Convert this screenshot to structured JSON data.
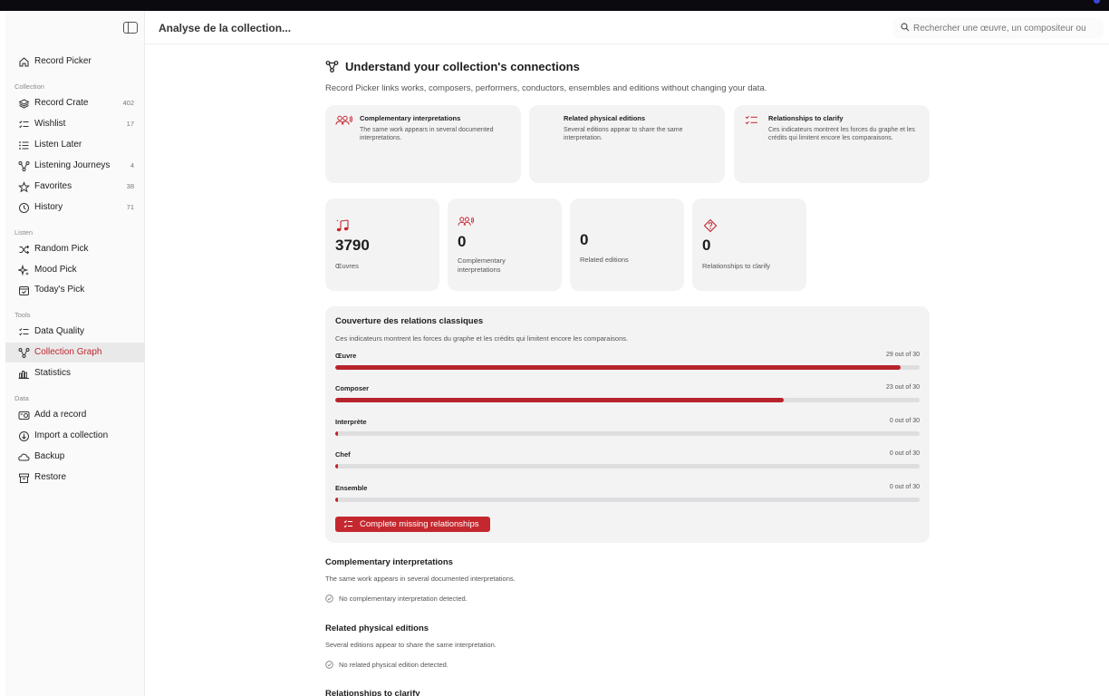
{
  "header": {
    "title": "Analyse de la collection...",
    "search_placeholder": "Rechercher une œuvre, un compositeur ou"
  },
  "sidebar": {
    "app_item": {
      "label": "Record Picker",
      "icon": "home-icon"
    },
    "sections": [
      {
        "label": "Collection",
        "items": [
          {
            "label": "Record Crate",
            "count": "402",
            "icon": "layers-icon"
          },
          {
            "label": "Wishlist",
            "count": "17",
            "icon": "checklist-icon"
          },
          {
            "label": "Listen Later",
            "count": "",
            "icon": "list-icon"
          },
          {
            "label": "Listening Journeys",
            "count": "4",
            "icon": "graph-icon"
          },
          {
            "label": "Favorites",
            "count": "38",
            "icon": "star-icon"
          },
          {
            "label": "History",
            "count": "71",
            "icon": "clock-icon"
          }
        ]
      },
      {
        "label": "Listen",
        "items": [
          {
            "label": "Random Pick",
            "icon": "shuffle-icon"
          },
          {
            "label": "Mood Pick",
            "icon": "sparkle-icon"
          },
          {
            "label": "Today's Pick",
            "icon": "calendar-icon"
          }
        ]
      },
      {
        "label": "Tools",
        "items": [
          {
            "label": "Data Quality",
            "icon": "checklist-icon"
          },
          {
            "label": "Collection Graph",
            "icon": "graph-icon",
            "active": true
          },
          {
            "label": "Statistics",
            "icon": "bar-chart-icon"
          }
        ]
      },
      {
        "label": "Data",
        "items": [
          {
            "label": "Add a record",
            "icon": "add-record-icon"
          },
          {
            "label": "Import a collection",
            "icon": "import-icon"
          },
          {
            "label": "Backup",
            "icon": "cloud-icon"
          },
          {
            "label": "Restore",
            "icon": "archive-icon"
          }
        ]
      }
    ]
  },
  "main": {
    "title": "Understand your collection's connections",
    "subtitle": "Record Picker links works, composers, performers, conductors, ensembles and editions without changing your data.",
    "intro_cards": [
      {
        "title": "Complementary interpretations",
        "desc": "The same work appears in several documented interpretations.",
        "icon": "people-icon"
      },
      {
        "title": "Related physical editions",
        "desc": "Several editions appear to share the same interpretation.",
        "icon": ""
      },
      {
        "title": "Relationships to clarify",
        "desc": "Ces indicateurs montrent les forces du graphe et les crédits qui limitent encore les comparaisons.",
        "icon": "checklist-icon"
      }
    ],
    "stats": [
      {
        "value": "3790",
        "label": "Œuvres",
        "icon": "music-notes-icon"
      },
      {
        "value": "0",
        "label": "Complementary interpretations",
        "icon": "people-icon"
      },
      {
        "value": "0",
        "label": "Related editions",
        "icon": ""
      },
      {
        "value": "0",
        "label": "Relationships to clarify",
        "icon": "diamond-question-icon"
      }
    ],
    "coverage": {
      "title": "Couverture des relations classiques",
      "desc": "Ces indicateurs montrent les forces du graphe et les crédits qui limitent encore les comparaisons.",
      "rows": [
        {
          "name": "Œuvre",
          "count_text": "29 out of 30",
          "value": 29,
          "max": 30
        },
        {
          "name": "Composer",
          "count_text": "23 out of 30",
          "value": 23,
          "max": 30
        },
        {
          "name": "Interprète",
          "count_text": "0 out of 30",
          "value": 0,
          "max": 30
        },
        {
          "name": "Chef",
          "count_text": "0 out of 30",
          "value": 0,
          "max": 30
        },
        {
          "name": "Ensemble",
          "count_text": "0 out of 30",
          "value": 0,
          "max": 30
        }
      ],
      "button_label": "Complete missing relationships"
    },
    "sections": [
      {
        "title": "Complementary interpretations",
        "desc": "The same work appears in several documented interpretations.",
        "empty": "No complementary interpretation detected."
      },
      {
        "title": "Related physical editions",
        "desc": "Several editions appear to share the same interpretation.",
        "empty": "No related physical edition detected."
      },
      {
        "title": "Relationships to clarify"
      }
    ]
  },
  "colors": {
    "accent": "#c4282e",
    "bar_fill": "#b8232b",
    "bar_track": "#dedee0",
    "card_bg": "#f3f3f4"
  }
}
